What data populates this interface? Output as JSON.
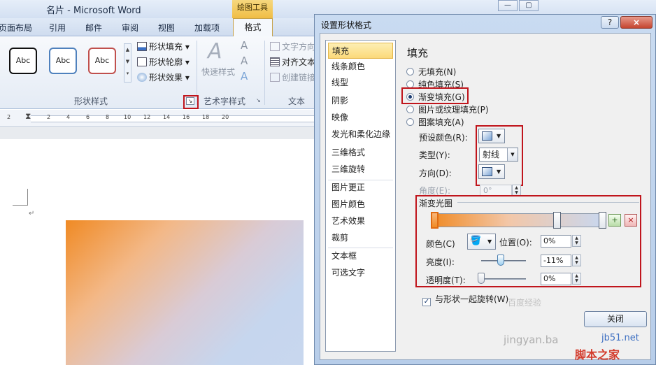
{
  "window": {
    "doc_title": "名片 - Microsoft Word",
    "contextual_tab": "绘图工具",
    "controls": {
      "minimize": "—",
      "restore": "▢"
    }
  },
  "ribbon": {
    "tabs": [
      {
        "label": "页面布局"
      },
      {
        "label": "引用"
      },
      {
        "label": "邮件"
      },
      {
        "label": "审阅"
      },
      {
        "label": "视图"
      },
      {
        "label": "加载项"
      }
    ],
    "active_tab": "格式",
    "shape_samples": [
      "Abc",
      "Abc",
      "Abc"
    ],
    "shape_fill": "形状填充",
    "shape_outline": "形状轮廓",
    "shape_effects": "形状效果",
    "quick_styles": "快速样式",
    "text_direction": "文字方向",
    "align_text": "对齐文本",
    "create_link": "创建链接",
    "groups": {
      "shape_styles": "形状样式",
      "wordart_styles": "艺术字样式",
      "text": "文本"
    },
    "icons": {
      "wordart_large": "A",
      "text_fill": "A",
      "text_outline": "A",
      "text_effects": "A",
      "launcher": "↘"
    }
  },
  "ruler": {
    "ticks": [
      "2",
      "",
      "2",
      "4",
      "6",
      "8",
      "10",
      "12",
      "14",
      "16",
      "18",
      "20"
    ]
  },
  "document": {
    "paragraph_mark": "↵"
  },
  "dialog": {
    "title": "设置形状格式",
    "help": "?",
    "close_x": "×",
    "categories": [
      "填充",
      "线条颜色",
      "线型",
      "阴影",
      "映像",
      "发光和柔化边缘",
      "三维格式",
      "三维旋转",
      "图片更正",
      "图片颜色",
      "艺术效果",
      "裁剪",
      "文本框",
      "可选文字"
    ],
    "selected_category": "填充",
    "panel_title": "填充",
    "fill_options": [
      {
        "label": "无填充(N)",
        "checked": false
      },
      {
        "label": "纯色填充(S)",
        "checked": false
      },
      {
        "label": "渐变填充(G)",
        "checked": true
      },
      {
        "label": "图片或纹理填充(P)",
        "checked": false
      },
      {
        "label": "图案填充(A)",
        "checked": false
      }
    ],
    "preset_colors_label": "预设颜色(R):",
    "type_label": "类型(Y):",
    "type_value": "射线",
    "direction_label": "方向(D):",
    "angle_label": "角度(E):",
    "angle_value": "0°",
    "gradient_stops_label": "渐变光圈",
    "stop_add": "+",
    "stop_remove": "×",
    "color_label": "颜色(C)",
    "position_label": "位置(O):",
    "position_value": "0%",
    "brightness_label": "亮度(I):",
    "brightness_value": "-11%",
    "brightness_level": -0.11,
    "transparency_label": "透明度(T):",
    "transparency_value": "0%",
    "transparency_level": 0,
    "rotate_with_shape_label": "与形状一起旋转(W)",
    "rotate_with_shape_checked": true,
    "close_button": "关闭"
  },
  "watermarks": {
    "jb51": "jb51.net",
    "site": "脚本之家",
    "jingyan": "jingyan.ba",
    "baidu": "百度经验"
  },
  "colors": {
    "highlight_red": "#c0151c",
    "gradient_start": "#f08a24",
    "gradient_end": "#c8d7ee",
    "selected_item": "#fbd97a"
  }
}
